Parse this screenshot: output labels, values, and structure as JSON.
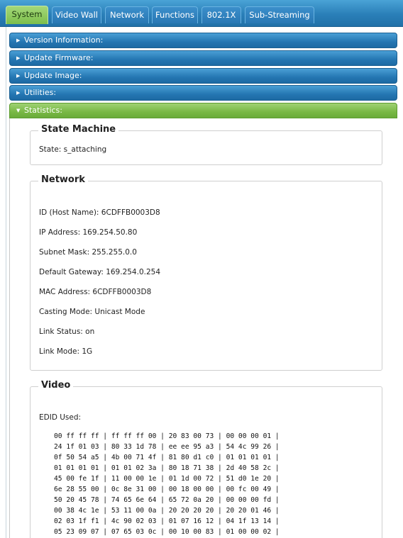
{
  "tabs": [
    {
      "label": "System",
      "active": true
    },
    {
      "label": "Video Wall",
      "active": false
    },
    {
      "label": "Network",
      "active": false
    },
    {
      "label": "Functions",
      "active": false
    },
    {
      "label": "802.1X",
      "active": false
    },
    {
      "label": "Sub-Streaming",
      "active": false
    }
  ],
  "accordion": [
    {
      "label": "Version Information:",
      "open": false
    },
    {
      "label": "Update Firmware:",
      "open": false
    },
    {
      "label": "Update Image:",
      "open": false
    },
    {
      "label": "Utilities:",
      "open": false
    },
    {
      "label": "Statistics:",
      "open": true
    }
  ],
  "state_machine": {
    "title": "State Machine",
    "state": "State: s_attaching"
  },
  "network": {
    "title": "Network",
    "lines": [
      "ID (Host Name): 6CDFFB0003D8",
      "IP Address: 169.254.50.80",
      "Subnet Mask: 255.255.0.0",
      "Default Gateway: 169.254.0.254",
      "MAC Address: 6CDFFB0003D8",
      "Casting Mode: Unicast Mode",
      "Link Status: on",
      "Link Mode: 1G"
    ]
  },
  "video": {
    "title": "Video",
    "edid_label": "EDID Used:",
    "edid_rows": [
      "00 ff ff ff | ff ff ff 00 | 20 83 00 73 | 00 00 00 01 |",
      "24 1f 01 03 | 80 33 1d 78 | ee ee 95 a3 | 54 4c 99 26 |",
      "0f 50 54 a5 | 4b 00 71 4f | 81 80 d1 c0 | 01 01 01 01 |",
      "01 01 01 01 | 01 01 02 3a | 80 18 71 38 | 2d 40 58 2c |",
      "45 00 fe 1f | 11 00 00 1e | 01 1d 00 72 | 51 d0 1e 20 |",
      "6e 28 55 00 | 0c 8e 31 00 | 00 18 00 00 | 00 fc 00 49 |",
      "50 20 45 78 | 74 65 6e 64 | 65 72 0a 20 | 00 00 00 fd |",
      "00 38 4c 1e | 53 11 00 0a | 20 20 20 20 | 20 20 01 46 |",
      "02 03 1f f1 | 4c 90 02 03 | 01 07 16 12 | 04 1f 13 14 |",
      "05 23 09 07 | 07 65 03 0c | 00 10 00 83 | 01 00 00 02 |"
    ]
  },
  "colors": {
    "tab_bar": "#2a7fb8",
    "active_tab": "#7dbf4b",
    "accordion": "#2476b2",
    "accordion_open": "#78b844"
  }
}
